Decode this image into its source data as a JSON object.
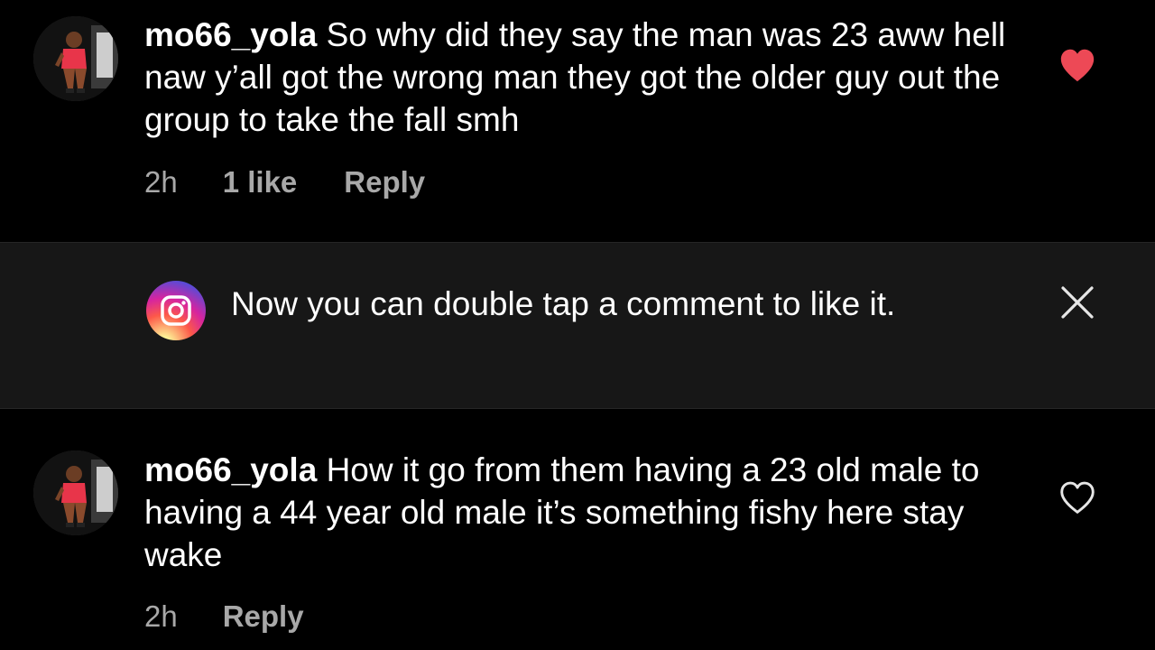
{
  "comments": [
    {
      "username": "mo66_yola",
      "text": "So why did they say the man was 23 aww hell naw y’all got the wrong man they got the older guy out the group to take the fall smh",
      "time": "2h",
      "likes": "1 like",
      "reply_label": "Reply",
      "liked": true,
      "heart_icon": "heart-filled-icon"
    },
    {
      "username": "mo66_yola",
      "text": "How it go from them having a 23 old male to having a 44 year old male it’s something fishy here stay wake",
      "time": "2h",
      "reply_label": "Reply",
      "liked": false,
      "heart_icon": "heart-outline-icon"
    }
  ],
  "tip": {
    "text": "Now you can double tap a comment to like it.",
    "logo_icon": "instagram-logo-icon",
    "close_icon": "close-icon"
  },
  "colors": {
    "background": "#000000",
    "tip_background": "#171717",
    "secondary_text": "#a8a8a8",
    "liked_heart": "#ed4956"
  }
}
